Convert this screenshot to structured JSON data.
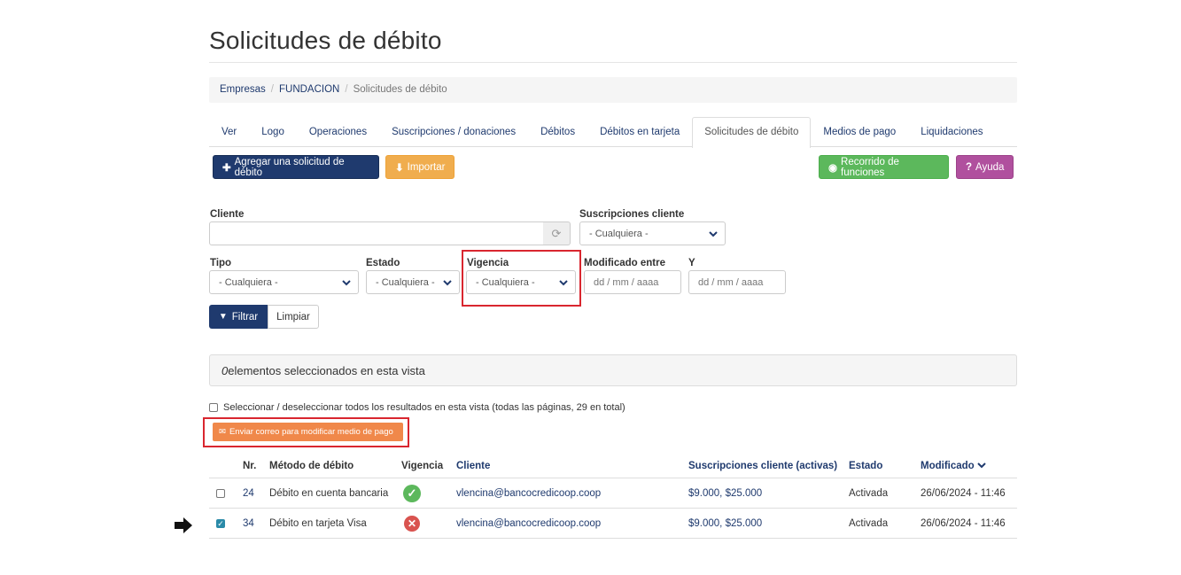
{
  "page": {
    "title": "Solicitudes de débito"
  },
  "breadcrumb": [
    {
      "label": "Empresas"
    },
    {
      "label": "FUNDACION"
    },
    {
      "label": "Solicitudes de débito"
    }
  ],
  "tabs": [
    {
      "label": "Ver"
    },
    {
      "label": "Logo"
    },
    {
      "label": "Operaciones"
    },
    {
      "label": "Suscripciones / donaciones"
    },
    {
      "label": "Débitos"
    },
    {
      "label": "Débitos en tarjeta"
    },
    {
      "label": "Solicitudes de débito",
      "active": true
    },
    {
      "label": "Medios de pago"
    },
    {
      "label": "Liquidaciones"
    }
  ],
  "toolbar": {
    "add_label": "Agregar una solicitud de débito",
    "import_label": "Importar",
    "tour_label": "Recorrido de funciones",
    "help_label": "Ayuda"
  },
  "filters": {
    "cliente_label": "Cliente",
    "cliente_value": "",
    "suscripciones_label": "Suscripciones cliente",
    "suscripciones_value": "- Cualquiera -",
    "tipo_label": "Tipo",
    "tipo_value": "- Cualquiera -",
    "estado_label": "Estado",
    "estado_value": "- Cualquiera -",
    "vigencia_label": "Vigencia",
    "vigencia_value": "- Cualquiera -",
    "modificado_label": "Modificado entre",
    "modificado_placeholder": "dd / mm / aaaa",
    "y_label": "Y",
    "y_placeholder": "dd / mm / aaaa",
    "filter_label": "Filtrar",
    "clear_label": "Limpiar"
  },
  "selection": {
    "count": "0",
    "text": "elementos seleccionados en esta vista",
    "select_all_label": "Seleccionar / deseleccionar todos los resultados en esta vista (todas las páginas, 29 en total)",
    "mail_button_label": "Enviar correo para modificar medio de pago"
  },
  "table": {
    "headers": {
      "nr": "Nr.",
      "metodo": "Método de débito",
      "vigencia": "Vigencia",
      "cliente": "Cliente",
      "suscripciones": "Suscripciones cliente (activas)",
      "estado": "Estado",
      "modificado": "Modificado"
    },
    "rows": [
      {
        "nr": "24",
        "metodo": "Débito en cuenta bancaria",
        "vigencia": "ok",
        "cliente": "vlencina@bancocredicoop.coop",
        "suscripciones": "$9.000, $25.000",
        "estado": "Activada",
        "modificado": "26/06/2024 - 11:46",
        "checked": false
      },
      {
        "nr": "34",
        "metodo": "Débito en tarjeta Visa",
        "vigencia": "ko",
        "cliente": "vlencina@bancocredicoop.coop",
        "suscripciones": "$9.000, $25.000",
        "estado": "Activada",
        "modificado": "26/06/2024 - 11:46",
        "checked": true
      }
    ]
  },
  "colors": {
    "primary": "#1f3a6e",
    "warning": "#f0ad4e",
    "success": "#5cb85c",
    "help": "#b0509e",
    "danger": "#d9534f",
    "highlight": "#d9262f"
  },
  "icons": [
    "plus-icon",
    "import-icon",
    "globe-icon",
    "question-icon",
    "refresh-icon",
    "chevron-down-icon",
    "filter-icon",
    "envelope-icon",
    "check-icon",
    "cross-icon",
    "arrow-right-icon"
  ]
}
